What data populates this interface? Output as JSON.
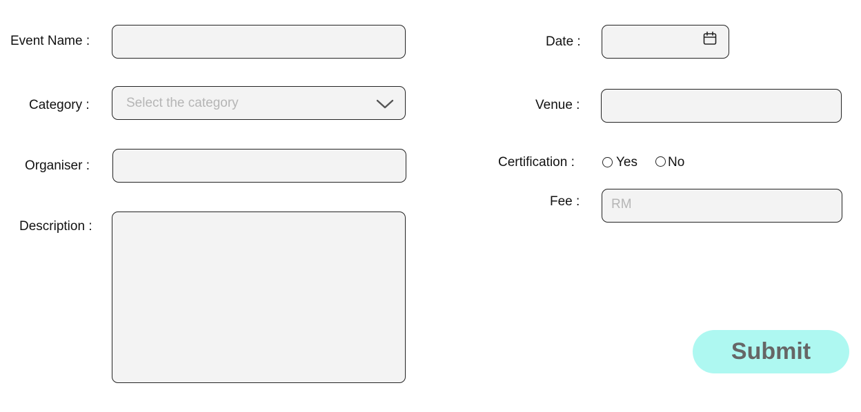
{
  "form": {
    "event_name": {
      "label": "Event Name :",
      "value": ""
    },
    "category": {
      "label": "Category :",
      "placeholder": "Select the category",
      "icon": "chevron-down-icon"
    },
    "organiser": {
      "label": "Organiser :",
      "value": ""
    },
    "description": {
      "label": "Description :",
      "value": ""
    },
    "date": {
      "label": "Date :",
      "value": "",
      "icon": "calendar-icon"
    },
    "venue": {
      "label": "Venue :",
      "value": ""
    },
    "certification": {
      "label": "Certification :",
      "options": [
        {
          "label": "Yes",
          "selected": false
        },
        {
          "label": "No",
          "selected": false
        }
      ]
    },
    "fee": {
      "label": "Fee :",
      "placeholder": "RM",
      "value": ""
    },
    "submit_label": "Submit"
  },
  "colors": {
    "field_background": "#f3f3f3",
    "field_border": "#222222",
    "placeholder_text": "#b5b5b5",
    "submit_background": "#aef8f1",
    "submit_text": "#666666"
  }
}
